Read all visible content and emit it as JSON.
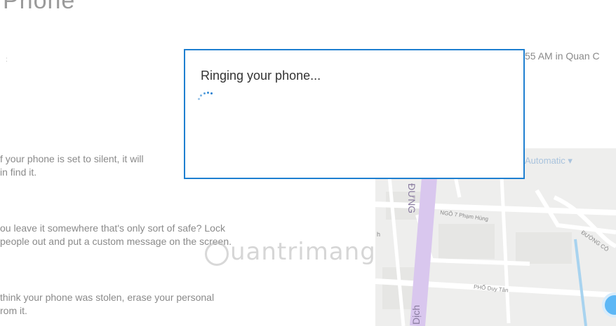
{
  "header": {
    "title": "Phone"
  },
  "location": {
    "text": "55 AM in Quan C"
  },
  "info": {
    "ring": "f your phone is set to silent, it will\nin find it.",
    "lock": "ou leave it somewhere that's only sort of safe? Lock\n people out and put a custom message on the screen.",
    "erase": " think your phone was stolen, erase your personal\nrom it."
  },
  "map": {
    "mode": "Automatic ▾",
    "labels": {
      "ngo": "NGÕ 7 Phạm Hùng",
      "duong": "ĐƯỜNG CÔ",
      "pho": "PHỐ Duy Tân",
      "dich": "Dịch",
      "dung": "ĐƯNG",
      "h": "h"
    }
  },
  "dialog": {
    "title": "Ringing your phone..."
  },
  "watermark": {
    "text": "uantrimang"
  },
  "colors": {
    "accent": "#1e7fd0",
    "map_road": "#ffffff",
    "map_purple": "#d9c7ee",
    "map_bg": "#eeeeed"
  }
}
